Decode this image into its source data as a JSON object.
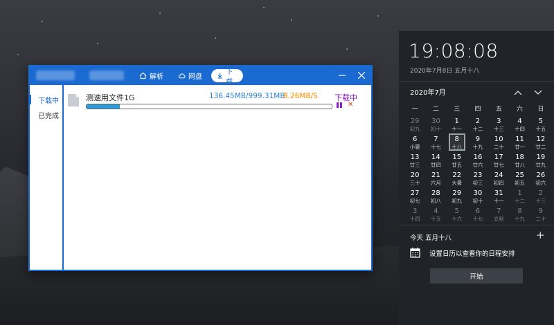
{
  "app": {
    "tabs": [
      {
        "label": "解析",
        "icon": "home-icon"
      },
      {
        "label": "网盘",
        "icon": "cloud-icon"
      },
      {
        "label": "下载",
        "icon": "download-arrow-icon",
        "active": true
      }
    ],
    "sidebar": [
      {
        "label": "下载中",
        "active": true
      },
      {
        "label": "已完成",
        "active": false
      }
    ],
    "task": {
      "name": "测速用文件1G",
      "size": "136.45MB/999.31MB",
      "speed": "8.26MB/S",
      "status": "下载中",
      "progress": 0.137
    },
    "colors": {
      "accent": "#1b6ad1",
      "speed": "#ff8a00",
      "status": "#8b1cc8",
      "progress": "#2d9cdb"
    }
  },
  "calendar": {
    "time": "19:08:08",
    "date": "2020年7月8日 五月十八",
    "month": "2020年7月",
    "weekdays": [
      "一",
      "二",
      "三",
      "四",
      "五",
      "六",
      "日"
    ],
    "days": [
      {
        "d": "29",
        "l": "初九",
        "out": true
      },
      {
        "d": "30",
        "l": "初十",
        "out": true
      },
      {
        "d": "1",
        "l": "十一"
      },
      {
        "d": "2",
        "l": "十二"
      },
      {
        "d": "3",
        "l": "十三"
      },
      {
        "d": "4",
        "l": "十四"
      },
      {
        "d": "5",
        "l": "十五"
      },
      {
        "d": "6",
        "l": "小暑"
      },
      {
        "d": "7",
        "l": "十七"
      },
      {
        "d": "8",
        "l": "十八",
        "today": true
      },
      {
        "d": "9",
        "l": "十九"
      },
      {
        "d": "10",
        "l": "二十"
      },
      {
        "d": "11",
        "l": "廿一"
      },
      {
        "d": "12",
        "l": "廿二"
      },
      {
        "d": "13",
        "l": "廿三"
      },
      {
        "d": "14",
        "l": "廿四"
      },
      {
        "d": "15",
        "l": "廿五"
      },
      {
        "d": "16",
        "l": "廿六"
      },
      {
        "d": "17",
        "l": "廿七"
      },
      {
        "d": "18",
        "l": "廿八"
      },
      {
        "d": "19",
        "l": "廿九"
      },
      {
        "d": "20",
        "l": "三十"
      },
      {
        "d": "21",
        "l": "六月"
      },
      {
        "d": "22",
        "l": "大暑"
      },
      {
        "d": "23",
        "l": "初三"
      },
      {
        "d": "24",
        "l": "初四"
      },
      {
        "d": "25",
        "l": "初五"
      },
      {
        "d": "26",
        "l": "初六"
      },
      {
        "d": "27",
        "l": "初七"
      },
      {
        "d": "28",
        "l": "初八"
      },
      {
        "d": "29",
        "l": "初九"
      },
      {
        "d": "30",
        "l": "初十"
      },
      {
        "d": "31",
        "l": "十一"
      },
      {
        "d": "1",
        "l": "十二",
        "out": true
      },
      {
        "d": "2",
        "l": "十三",
        "out": true
      },
      {
        "d": "3",
        "l": "十四",
        "out": true
      },
      {
        "d": "4",
        "l": "十五",
        "out": true
      },
      {
        "d": "5",
        "l": "十六",
        "out": true
      },
      {
        "d": "6",
        "l": "十七",
        "out": true
      },
      {
        "d": "7",
        "l": "立秋",
        "out": true
      },
      {
        "d": "8",
        "l": "十九",
        "out": true
      },
      {
        "d": "9",
        "l": "二十",
        "out": true
      }
    ],
    "today_title": "今天 五月十八",
    "agenda_text": "设置日历以查看你的日程安排",
    "start_label": "开始"
  }
}
